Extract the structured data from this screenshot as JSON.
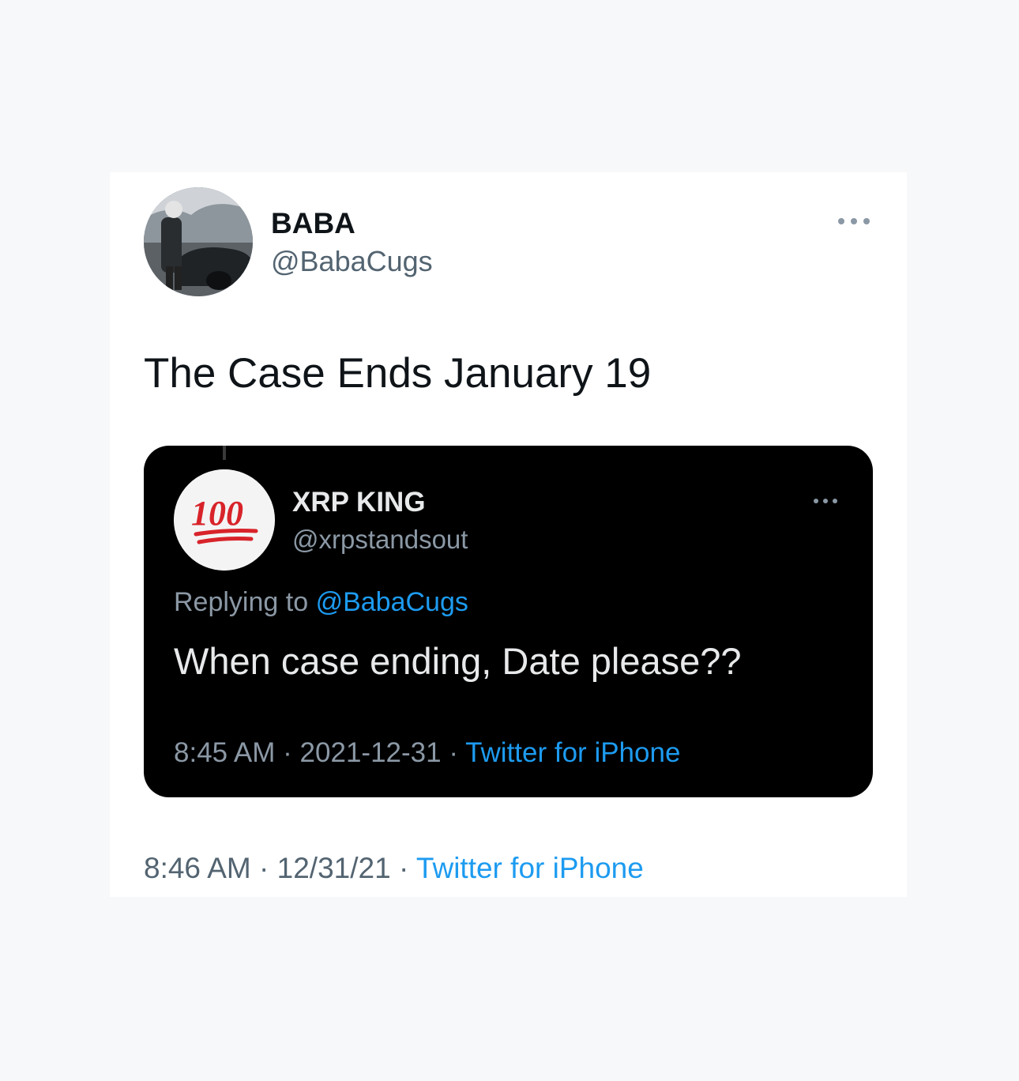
{
  "tweet": {
    "display_name": "BABA",
    "handle": "@BabaCugs",
    "text": "The Case Ends January 19",
    "time": "8:46 AM",
    "date": "12/31/21",
    "source": "Twitter for iPhone",
    "separator": "·",
    "more_icon": "more-horizontal-icon"
  },
  "quoted_tweet": {
    "avatar_icon": "hundred-points-icon",
    "display_name": "XRP KING",
    "handle": "@xrpstandsout",
    "replying_prefix": "Replying to",
    "replying_to": "@BabaCugs",
    "text": "When case ending, Date please??",
    "time": "8:45 AM",
    "date": "2021-12-31",
    "source": "Twitter for iPhone",
    "separator": "·",
    "more_icon": "more-horizontal-icon"
  },
  "colors": {
    "link": "#1d9bf0",
    "quote_background": "#000000",
    "card_background": "#ffffff",
    "hundred_red": "#d8232a"
  }
}
